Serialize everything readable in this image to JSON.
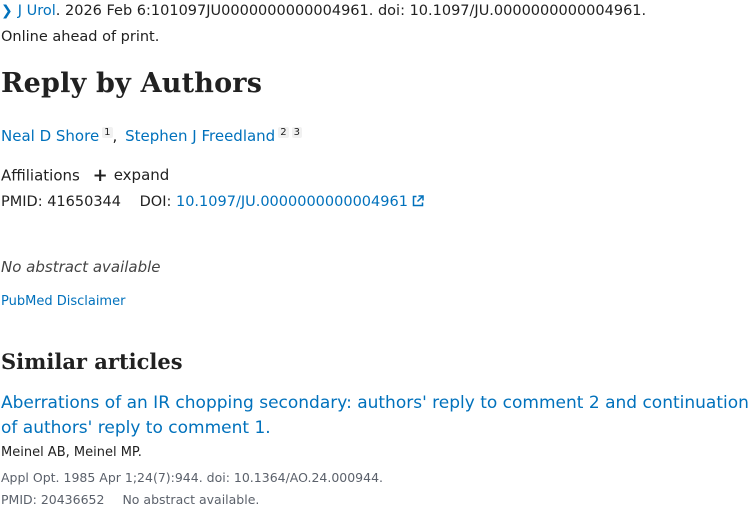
{
  "citation": {
    "journal": "J Urol",
    "rest": ". 2026 Feb 6:101097JU0000000000004961. doi: 10.1097/JU.0000000000004961."
  },
  "status": "Online ahead of print.",
  "title": "Reply by Authors",
  "authors": [
    {
      "name": "Neal D Shore",
      "refs": [
        "1"
      ]
    },
    {
      "name": "Stephen J Freedland",
      "refs": [
        "2",
        "3"
      ]
    }
  ],
  "authors_separator": ",",
  "affiliations": {
    "label": "Affiliations",
    "expand_label": "expand"
  },
  "identifiers": {
    "pmid_label": "PMID:",
    "pmid": "41650344",
    "doi_label": "DOI:",
    "doi": "10.1097/JU.0000000000004961"
  },
  "abstract_note": "No abstract available",
  "disclaimer": "PubMed Disclaimer",
  "similar": {
    "heading": "Similar articles",
    "articles": [
      {
        "title": "Aberrations of an IR chopping secondary: authors' reply to comment 2 and continuation of authors' reply to comment 1.",
        "authors": "Meinel AB, Meinel MP.",
        "citation": "Appl Opt. 1985 Apr 1;24(7):944. doi: 10.1364/AO.24.000944."
      }
    ],
    "next_partial": {
      "pmid": "PMID: 20436652",
      "note": "No abstract available."
    }
  },
  "colors": {
    "link": "#0071bc",
    "text": "#212121",
    "muted": "#5b616b"
  },
  "icons": {
    "chevron": "chevron-right-icon",
    "plus": "plus-icon",
    "external": "external-link-icon"
  }
}
